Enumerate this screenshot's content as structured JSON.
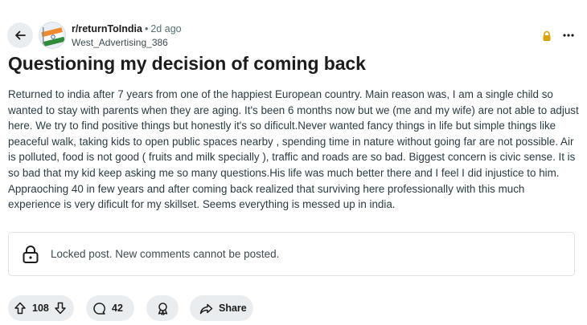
{
  "post": {
    "subreddit": "r/returnToIndia",
    "time_separator": "•",
    "time_ago": "2d ago",
    "author": "West_Advertising_386",
    "title": "Questioning my decision of coming back",
    "body": "Returned to india after 7 years from one of the happiest European country. Main reason was, I am a single child so wanted to stay with parents when they are aging. It's been 6 months now but we (me and my wife) are not able to adjust here. We try to find positive things but honestly it's so dificult.Never wanted fancy things in life but simple things like peaceful walk, taking kids to open public spaces nearby , spending time in nature without going far are not possible. Air is polluted, food is not good ( fruits and milk specially ), traffic and roads are so bad. Biggest concern is civic sense. It is so bad that my kid keep asking me so many questions.His life was much better there and I feel I did injustice to him. Appraoching 40 in few years and after coming back realized that surviving here professionally with this much experience is very dificult for my skillset. Seems everything is messed up in india."
  },
  "locked_notice": "Locked post. New comments cannot be posted.",
  "actions": {
    "vote_count": "108",
    "comment_count": "42",
    "share_label": "Share"
  },
  "icons": {
    "back": "arrow-left-icon",
    "lock_indicator": "lock-icon",
    "more": "more-horizontal-icon",
    "locked": "padlock-icon",
    "upvote": "arrow-up-icon",
    "downvote": "arrow-down-icon",
    "comment": "speech-bubble-icon",
    "award": "award-icon",
    "share": "share-arrow-icon"
  },
  "colors": {
    "lock_indicator": "#d8a300",
    "pill_bg": "#eaedef",
    "meta_text": "#576f76"
  }
}
